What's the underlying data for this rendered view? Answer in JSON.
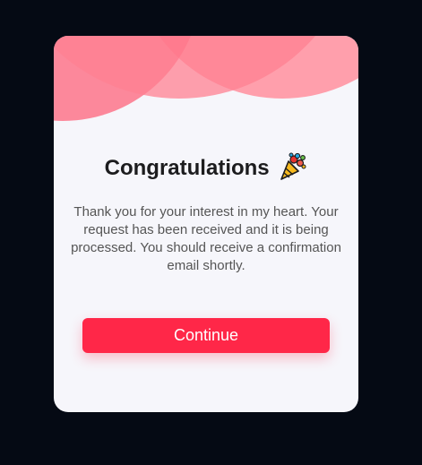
{
  "dialog": {
    "title": "Congratulations",
    "title_icon": "party-popper-icon",
    "message": "Thank you for your interest in my heart. Your request has been received and it is being processed. You should receive a confirmation email shortly.",
    "continue_label": "Continue"
  },
  "colors": {
    "page_background": "#050a14",
    "card_background": "#f6f6fb",
    "accent": "#ff2748",
    "decor_light": "#ff9aa8",
    "decor_mid": "#ff7d8e",
    "decor_dark": "#ff4d66"
  }
}
